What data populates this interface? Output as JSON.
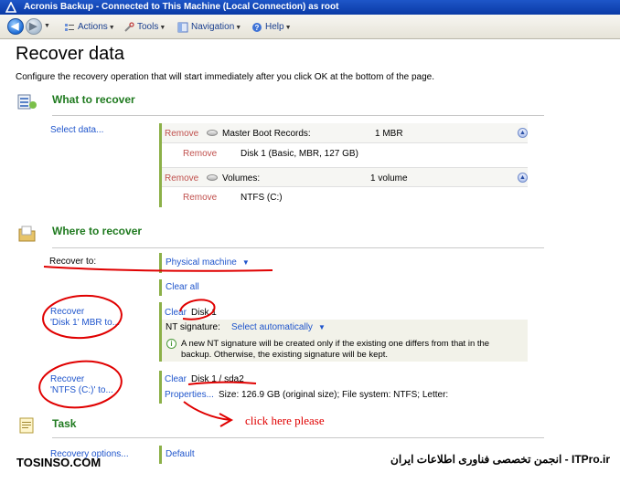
{
  "window": {
    "title": "Acronis Backup - Connected to This Machine (Local Connection) as root"
  },
  "toolbar": {
    "actions": "Actions",
    "tools": "Tools",
    "navigation": "Navigation",
    "help": "Help"
  },
  "page": {
    "title": "Recover data",
    "subtitle": "Configure the recovery operation that will start immediately after you click OK at the bottom of the page."
  },
  "what_to_recover": {
    "heading": "What to recover",
    "select_data_link": "Select data...",
    "groups": [
      {
        "remove": "Remove",
        "label": "Master Boot Records:",
        "count": "1 MBR",
        "item_remove": "Remove",
        "item": "Disk 1 (Basic, MBR, 127 GB)"
      },
      {
        "remove": "Remove",
        "label": "Volumes:",
        "count": "1 volume",
        "item_remove": "Remove",
        "item": "NTFS (C:)"
      }
    ]
  },
  "where_to_recover": {
    "heading": "Where to recover",
    "recover_to_label": "Recover to:",
    "recover_to_value": "Physical machine",
    "clear_all": "Clear all",
    "mbr": {
      "label_line1": "Recover",
      "label_line2": "'Disk 1' MBR to...",
      "clear": "Clear",
      "target": "Disk 1",
      "nt_signature_label": "NT signature:",
      "nt_signature_value": "Select automatically",
      "info_line1": "A new NT signature will be created only if the existing one differs from that in the",
      "info_line2": "backup. Otherwise, the existing signature will be kept."
    },
    "volume": {
      "label_line1": "Recover",
      "label_line2": "'NTFS (C:)' to...",
      "clear": "Clear",
      "target": "Disk 1 / sda2",
      "properties": "Properties...",
      "properties_detail": "Size: 126.9 GB (original size); File system: NTFS; Letter:"
    }
  },
  "task": {
    "heading": "Task",
    "recovery_options": "Recovery options...",
    "default": "Default"
  },
  "annotation": {
    "text": "click here please"
  },
  "watermark": {
    "left": "TOSINSO.COM",
    "right": "انجمن تخصصی فناوری اطلاعات ایران - ITPro.ir"
  },
  "colors": {
    "titlebar": "#0a3aa6",
    "link": "#1f55cc",
    "section_heading": "#1f7a1f",
    "remove": "#c0504d",
    "panel_accent": "#8cb048",
    "annotation_red": "#e00000"
  }
}
